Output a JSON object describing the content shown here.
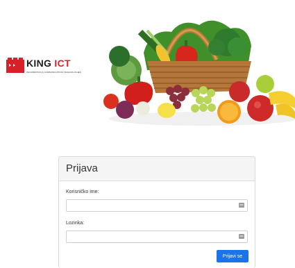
{
  "brand": {
    "name_part1": "KING",
    "name_part2": "ICT",
    "tagline": "INFORMATION & COMMUNICATION TECHNOLOGIES"
  },
  "login": {
    "title": "Prijava",
    "username_label": "Korisničko ime:",
    "username_value": "",
    "password_label": "Lozinka:",
    "password_value": "",
    "submit_label": "Prijavi se"
  },
  "colors": {
    "brand_red": "#d8202a",
    "primary_button": "#1a73e8",
    "panel_heading_bg": "#f5f5f5"
  },
  "icons": {
    "field_icon": "key-icon"
  }
}
